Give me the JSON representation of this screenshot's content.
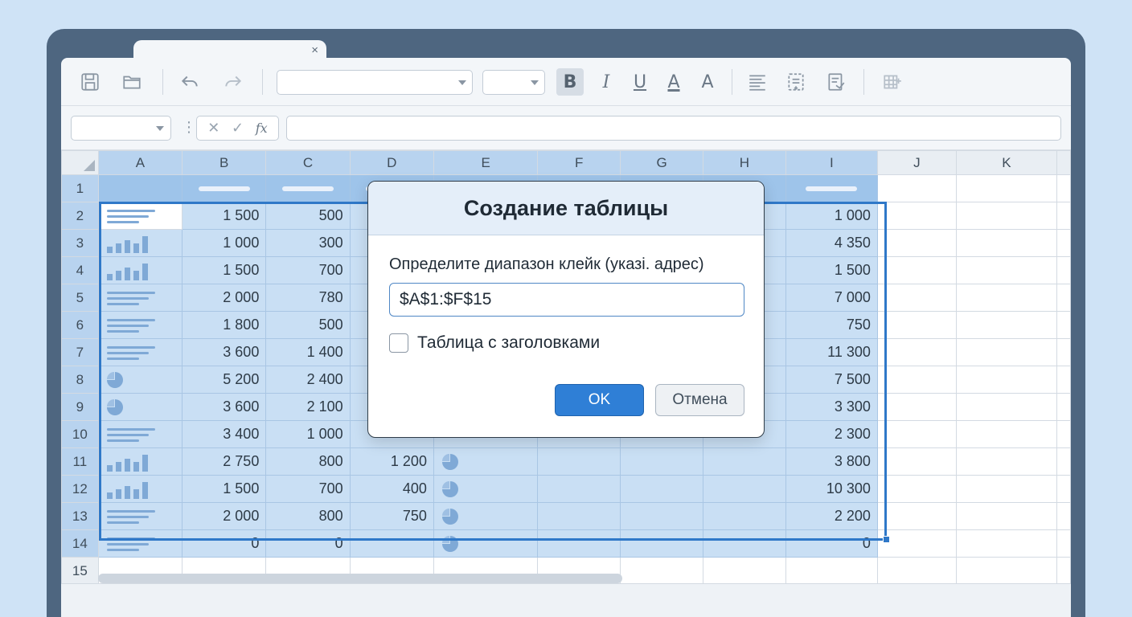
{
  "window": {
    "tab_close": "×"
  },
  "toolbar": {
    "font_name": "",
    "font_size": "",
    "bold": "B",
    "italic": "I",
    "underline": "U",
    "font_color": "A",
    "highlight": "A"
  },
  "formula_bar": {
    "name_box": "",
    "cancel": "✕",
    "confirm": "✓",
    "fx": "fx",
    "formula": ""
  },
  "columns": [
    "A",
    "B",
    "C",
    "D",
    "E",
    "F",
    "G",
    "H",
    "I",
    "J",
    "K"
  ],
  "rows": [
    {
      "num": "1",
      "A": "header",
      "B": "",
      "C": "",
      "D": "",
      "I": ""
    },
    {
      "num": "2",
      "A": "lines",
      "B": "1 500",
      "C": "500",
      "D": "",
      "E": "",
      "I": "1 000"
    },
    {
      "num": "3",
      "A": "bars",
      "B": "1 000",
      "C": "300",
      "D": "",
      "E": "",
      "I": "4 350"
    },
    {
      "num": "4",
      "A": "bars",
      "B": "1 500",
      "C": "700",
      "D": "",
      "E": "",
      "I": "1 500"
    },
    {
      "num": "5",
      "A": "lines",
      "B": "2 000",
      "C": "780",
      "D": "",
      "E": "",
      "I": "7 000"
    },
    {
      "num": "6",
      "A": "lines",
      "B": "1 800",
      "C": "500",
      "D": "",
      "E": "",
      "I": "750"
    },
    {
      "num": "7",
      "A": "lines",
      "B": "3 600",
      "C": "1 400",
      "D": "",
      "E": "",
      "I": "11 300"
    },
    {
      "num": "8",
      "A": "pie",
      "B": "5 200",
      "C": "2 400",
      "D": "",
      "E": "",
      "I": "7 500"
    },
    {
      "num": "9",
      "A": "pie",
      "B": "3 600",
      "C": "2 100",
      "D": "",
      "E": "",
      "I": "3 300"
    },
    {
      "num": "10",
      "A": "lines",
      "B": "3 400",
      "C": "1 000",
      "D": "",
      "E": "",
      "I": "2 300"
    },
    {
      "num": "11",
      "A": "bars",
      "B": "2 750",
      "C": "800",
      "D": "1 200",
      "E": "pie",
      "I": "3 800"
    },
    {
      "num": "12",
      "A": "bars",
      "B": "1 500",
      "C": "700",
      "D": "400",
      "E": "pie",
      "I": "10 300"
    },
    {
      "num": "13",
      "A": "lines",
      "B": "2 000",
      "C": "800",
      "D": "750",
      "E": "pie",
      "I": "2 200"
    },
    {
      "num": "14",
      "A": "lines",
      "B": "0",
      "C": "0",
      "D": "",
      "E": "pie",
      "I": "0"
    },
    {
      "num": "15"
    }
  ],
  "dialog": {
    "title": "Создание таблицы",
    "range_label": "Определите диапазон клейк (указі. адрес)",
    "range_value": "$A$1:$F$15",
    "headers_checkbox_label": "Таблица с заголовками",
    "headers_checked": false,
    "ok_label": "OK",
    "cancel_label": "Отмена"
  },
  "colors": {
    "selection": "#c9dff4",
    "selection_border": "#2f78c8",
    "header_row": "#9ec4ea",
    "ok_button": "#2f7fd6",
    "frame": "#4e6680",
    "background": "#cfe3f6"
  }
}
